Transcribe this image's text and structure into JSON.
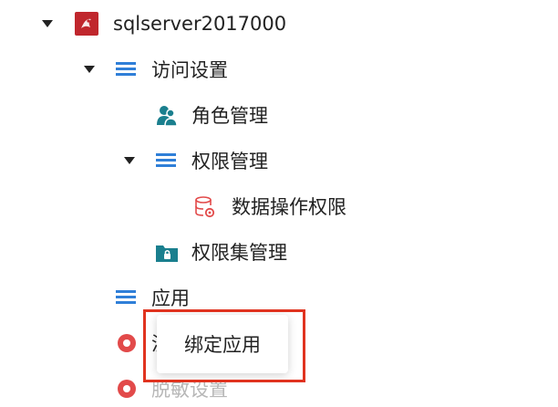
{
  "tree": {
    "root": {
      "label": "sqlserver2017000",
      "icon": "sqlserver-db-icon"
    },
    "access_settings": {
      "label": "访问设置",
      "icon": "list-icon"
    },
    "role_management": {
      "label": "角色管理",
      "icon": "users-icon"
    },
    "permission_management": {
      "label": "权限管理",
      "icon": "list-icon"
    },
    "data_operation_permission": {
      "label": "数据操作权限",
      "icon": "database-gear-icon"
    },
    "permission_set_management": {
      "label": "权限集管理",
      "icon": "locked-folder-icon"
    },
    "applications": {
      "label": "应用",
      "icon": "list-icon"
    },
    "hidden_item": {
      "label": "沪",
      "icon": "gear-icon"
    },
    "masking_settings": {
      "label": "脱敏设置",
      "icon": "gear-icon"
    }
  },
  "context_menu": {
    "bind_application": "绑定应用"
  },
  "colors": {
    "list_icon": "#2f7fd8",
    "teal_icon": "#1a7f8e",
    "gear_icon": "#e24a4a",
    "highlight_border": "#e0331f"
  }
}
